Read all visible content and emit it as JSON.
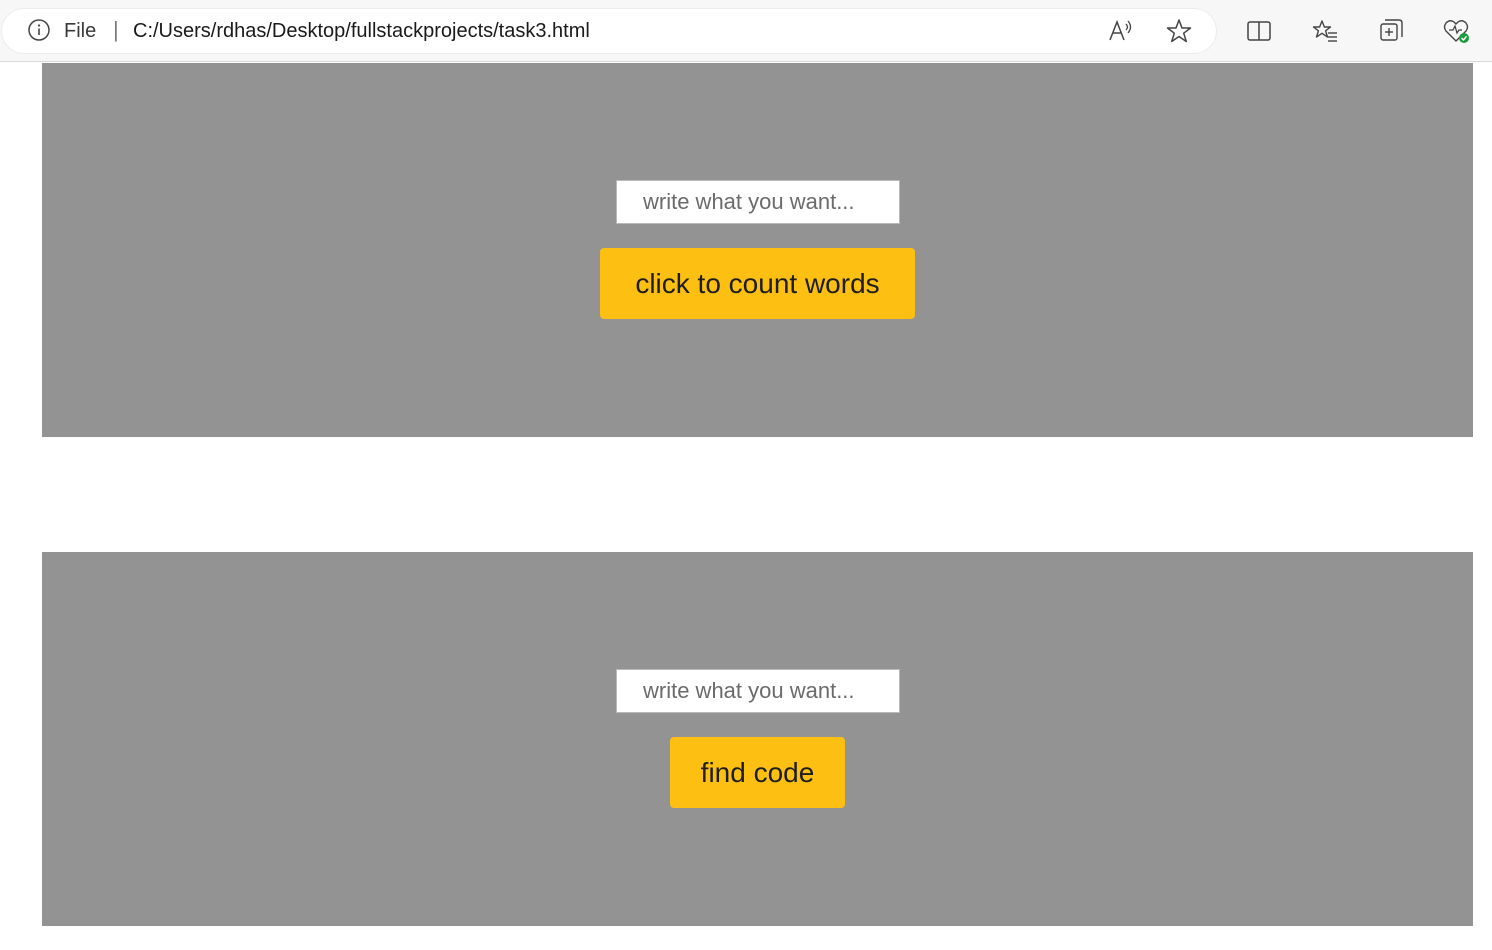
{
  "browser": {
    "file_label": "File",
    "separator": "|",
    "url": "C:/Users/rdhas/Desktop/fullstackprojects/task3.html",
    "icons": [
      "info-icon",
      "read-aloud-icon",
      "favorite-star-icon",
      "split-screen-icon",
      "favorites-icon",
      "collections-icon",
      "browser-essentials-icon"
    ]
  },
  "panels": [
    {
      "input_placeholder": "write what you want...",
      "button_label": "click to count words"
    },
    {
      "input_placeholder": "write what you want...",
      "button_label": "find code"
    }
  ],
  "colors": {
    "panel_bg": "#939393",
    "button_bg": "#fdbf12"
  }
}
